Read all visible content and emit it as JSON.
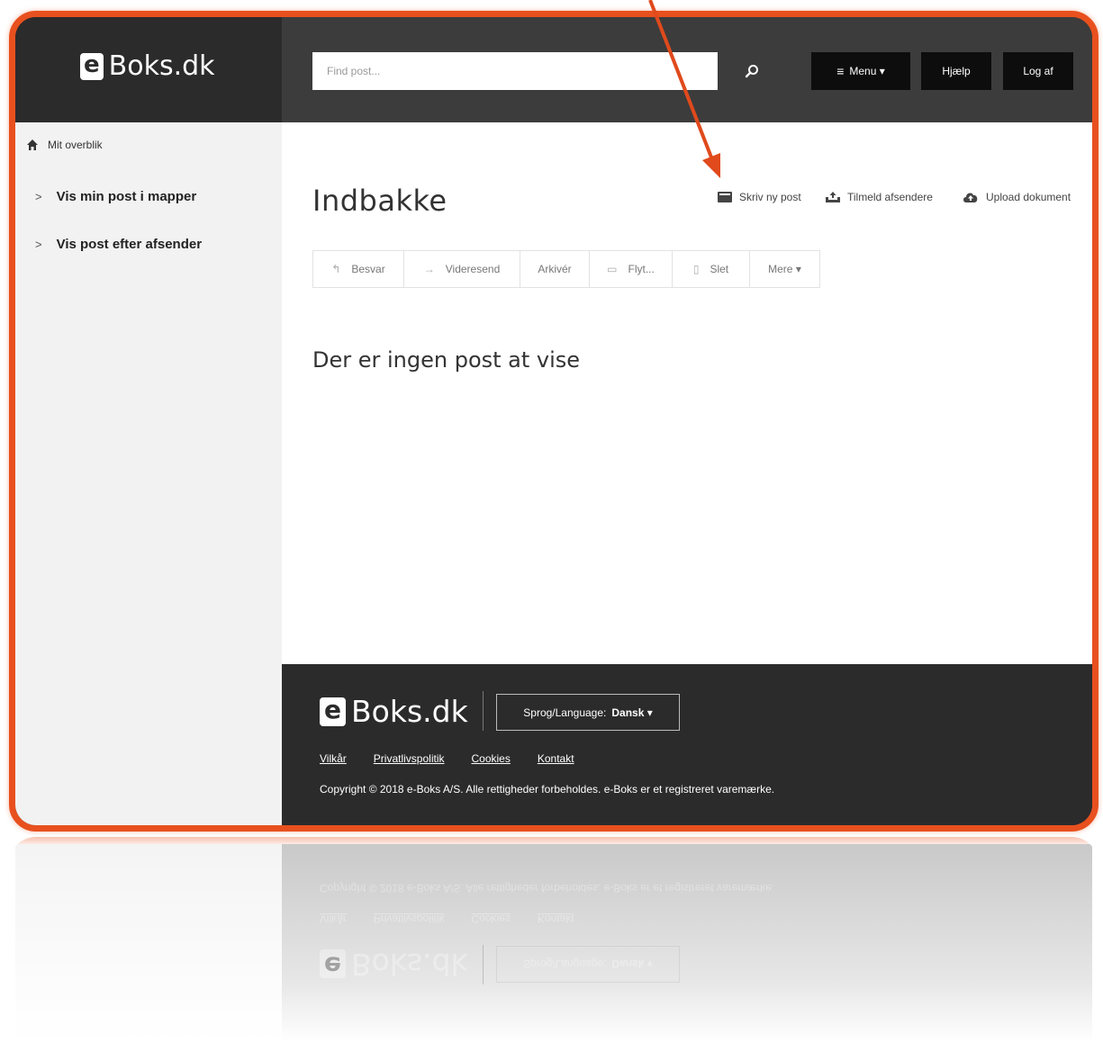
{
  "brand": {
    "logo_letter": "e",
    "logo_word": "Boks.dk"
  },
  "search": {
    "placeholder": "Find post..."
  },
  "topbar": {
    "menu_label": "Menu ▾",
    "help_label": "Hjælp",
    "logout_label": "Log af"
  },
  "sidebar": {
    "overview_label": "Mit overblik",
    "items": [
      {
        "label": "Vis min post i mapper"
      },
      {
        "label": "Vis post efter afsender"
      }
    ]
  },
  "main": {
    "title": "Indbakke",
    "actions": {
      "write": "Skriv ny post",
      "subscribe": "Tilmeld afsendere",
      "upload": "Upload dokument"
    },
    "toolbar": {
      "reply": "Besvar",
      "forward": "Videresend",
      "archive": "Arkivér",
      "move": "Flyt...",
      "delete": "Slet",
      "more": "Mere ▾"
    },
    "empty_message": "Der er ingen post at vise"
  },
  "footer": {
    "language_label": "Sprog/Language:",
    "language_value": "Dansk ▾",
    "links": [
      "Vilkår",
      "Privatlivspolitik",
      "Cookies",
      "Kontakt"
    ],
    "copyright": "Copyright © 2018 e-Boks A/S. Alle rettigheder forbeholdes. e-Boks er et registreret varemærke."
  },
  "colors": {
    "frame": "#e8501e",
    "arrow": "#e04a1c",
    "dark": "#2b2b2b",
    "topbar": "#3c3c3c"
  }
}
